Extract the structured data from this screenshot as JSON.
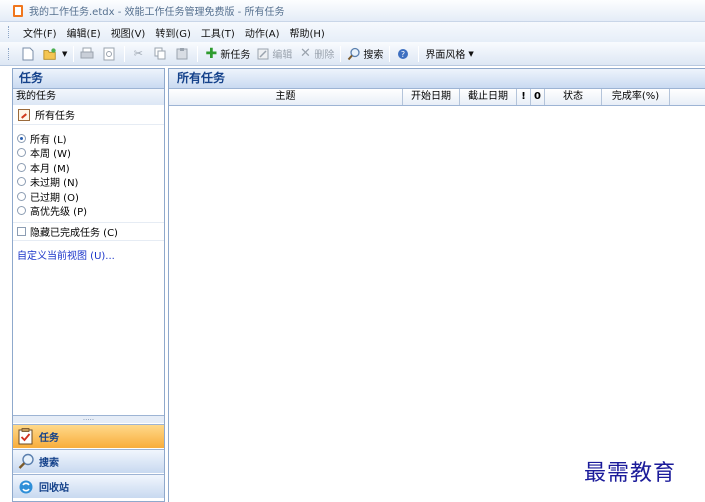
{
  "window": {
    "title": "我的工作任务.etdx - 效能工作任务管理免费版 - 所有任务"
  },
  "menu": [
    "文件(F)",
    "编辑(E)",
    "视图(V)",
    "转到(G)",
    "工具(T)",
    "动作(A)",
    "帮助(H)"
  ],
  "toolbar": {
    "new_task": "新任务",
    "edit": "编辑",
    "delete": "删除",
    "search": "搜索",
    "theme": "界面风格"
  },
  "left": {
    "header": "任务",
    "section": "我的任务",
    "all_tasks": "所有任务",
    "filters": [
      "所有 (L)",
      "本周 (W)",
      "本月 (M)",
      "未过期 (N)",
      "已过期 (O)",
      "高优先级 (P)"
    ],
    "selected_filter": "所有 (L)",
    "hide_completed": "隐藏已完成任务 (C)",
    "customize": "自定义当前视图 (U)..."
  },
  "nav": {
    "tasks": "任务",
    "search": "搜索",
    "recycle": "回收站"
  },
  "main": {
    "header": "所有任务",
    "columns": {
      "subject": "主题",
      "start": "开始日期",
      "due": "截止日期",
      "priority": "!",
      "attach": "0",
      "status": "状态",
      "complete": "完成率(%)"
    }
  },
  "watermark": "最需教育",
  "colors": {
    "accent": "#15428b",
    "active_nav": "#f8ad3c",
    "link": "#1a34c9"
  }
}
